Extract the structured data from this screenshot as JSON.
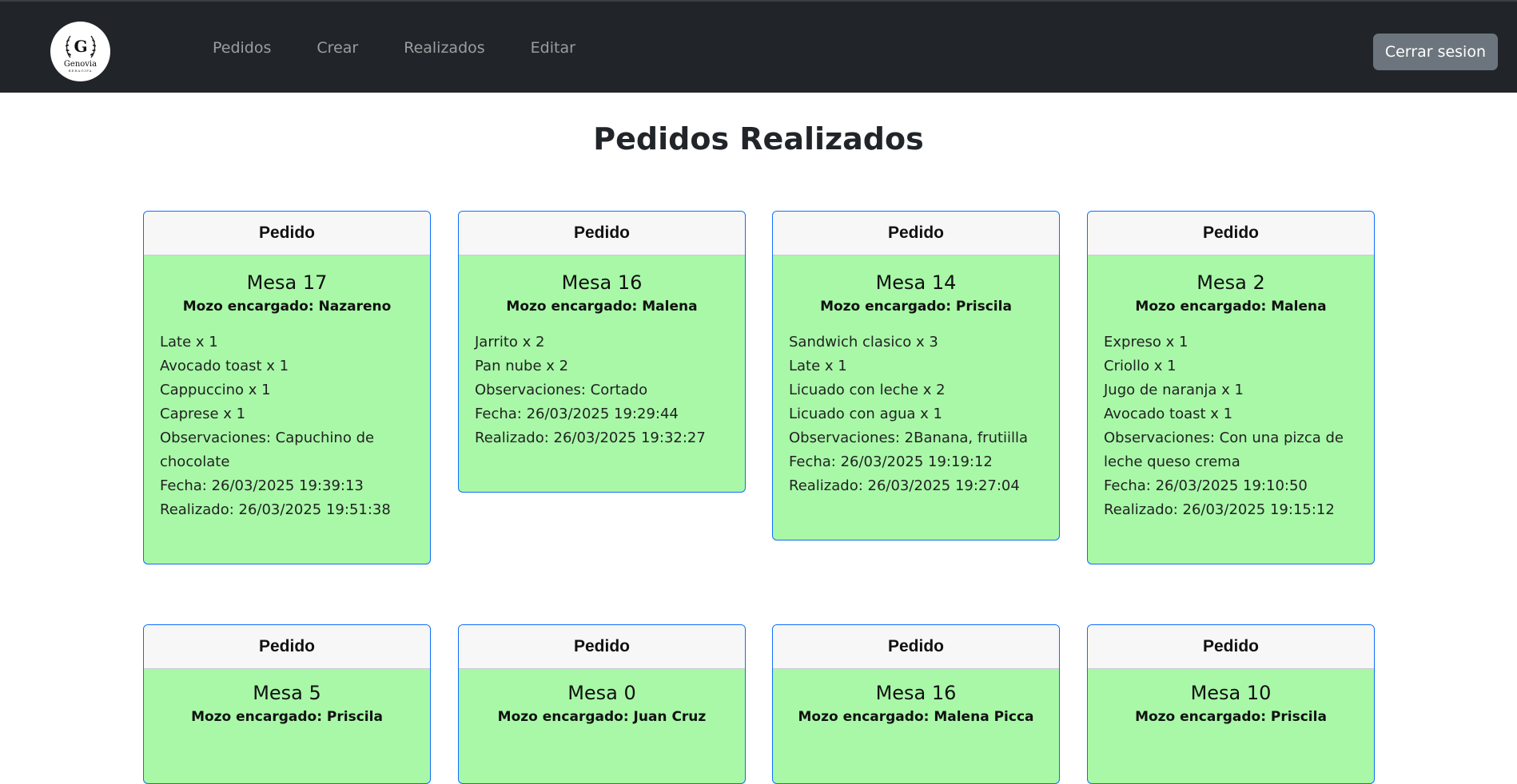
{
  "brand": {
    "logo_letter": "G",
    "logo_name": "Genovia",
    "logo_sub": "BERAGIFA"
  },
  "nav": {
    "links": [
      "Pedidos",
      "Crear",
      "Realizados",
      "Editar"
    ],
    "logout_label": "Cerrar sesion"
  },
  "page": {
    "title": "Pedidos Realizados"
  },
  "colors": {
    "card_bg": "#a8f8a8",
    "card_border": "#0d6efd",
    "navbar_bg": "#212529",
    "logout_bg": "#6c757d"
  },
  "orders": [
    {
      "header": "Pedido",
      "mesa": "Mesa 17",
      "mozo": "Mozo encargado: Nazareno",
      "lines": [
        "Late x 1",
        "Avocado toast x 1",
        "Cappuccino x 1",
        "Caprese x 1",
        "Observaciones: Capuchino de",
        "chocolate",
        "Fecha: 26/03/2025 19:39:13",
        "Realizado: 26/03/2025 19:51:38"
      ]
    },
    {
      "header": "Pedido",
      "mesa": "Mesa 16",
      "mozo": "Mozo encargado: Malena",
      "lines": [
        "Jarrito x 2",
        "Pan nube x 2",
        "Observaciones: Cortado",
        "Fecha: 26/03/2025 19:29:44",
        "Realizado: 26/03/2025 19:32:27"
      ]
    },
    {
      "header": "Pedido",
      "mesa": "Mesa 14",
      "mozo": "Mozo encargado: Priscila",
      "lines": [
        "Sandwich clasico x 3",
        "Late x 1",
        "Licuado con leche x 2",
        "Licuado con agua x 1",
        "Observaciones: 2Banana, frutiilla",
        "Fecha: 26/03/2025 19:19:12",
        "Realizado: 26/03/2025 19:27:04"
      ]
    },
    {
      "header": "Pedido",
      "mesa": "Mesa 2",
      "mozo": "Mozo encargado: Malena",
      "lines": [
        "Expreso x 1",
        "Criollo x 1",
        "Jugo de naranja x 1",
        "Avocado toast x 1",
        "Observaciones: Con una pizca de",
        "leche queso crema",
        "Fecha: 26/03/2025 19:10:50",
        "Realizado: 26/03/2025 19:15:12"
      ]
    },
    {
      "header": "Pedido",
      "mesa": "Mesa 5",
      "mozo": "Mozo encargado: Priscila",
      "lines": []
    },
    {
      "header": "Pedido",
      "mesa": "Mesa 0",
      "mozo": "Mozo encargado: Juan Cruz",
      "lines": []
    },
    {
      "header": "Pedido",
      "mesa": "Mesa 16",
      "mozo": "Mozo encargado: Malena Picca",
      "lines": []
    },
    {
      "header": "Pedido",
      "mesa": "Mesa 10",
      "mozo": "Mozo encargado: Priscila",
      "lines": []
    }
  ]
}
